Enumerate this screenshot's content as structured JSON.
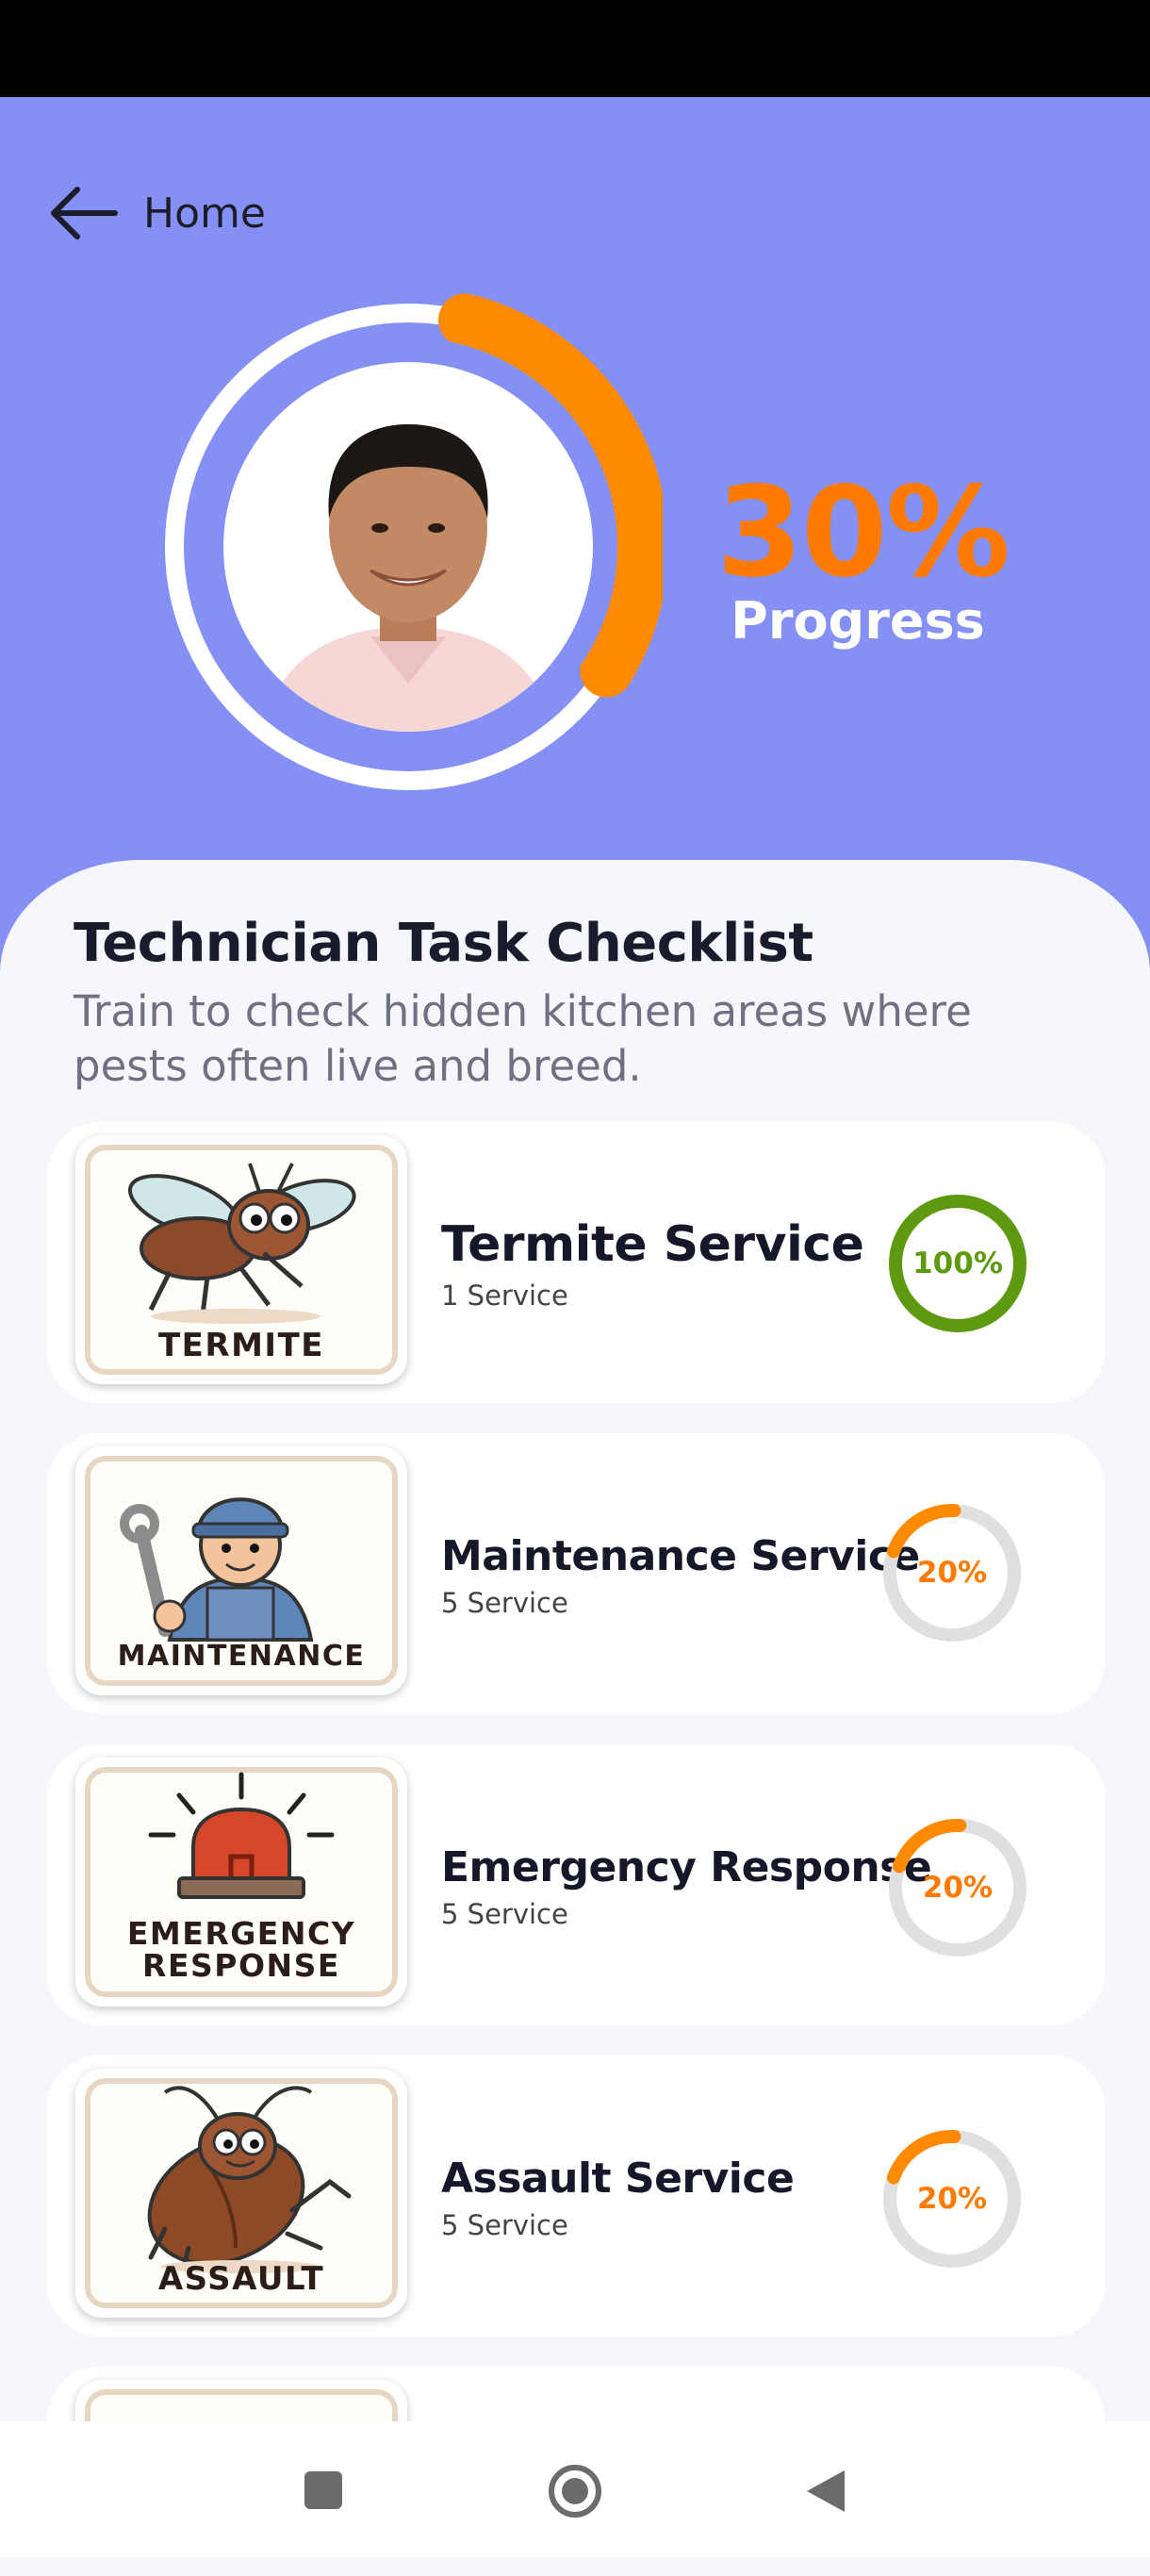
{
  "header": {
    "back_label": "Home",
    "progress_value": "30%",
    "progress_label": "Progress",
    "progress_fraction": 0.3
  },
  "checklist": {
    "title": "Technician Task Checklist",
    "subtitle": "Train to check hidden kitchen areas where pests often live and breed."
  },
  "tasks": [
    {
      "title": "Termite Service",
      "count": "1 Service",
      "percent_label": "100%",
      "progress": 1.0,
      "thumb_label": "TERMITE",
      "icon": "termite-icon"
    },
    {
      "title": "Maintenance Service",
      "count": "5 Service",
      "percent_label": "20%",
      "progress": 0.2,
      "thumb_label": "MAINTENANCE",
      "icon": "technician-wrench-icon"
    },
    {
      "title": "Emergency Response",
      "count": "5 Service",
      "percent_label": "20%",
      "progress": 0.2,
      "thumb_label_1": "EMERGENCY",
      "thumb_label_2": "RESPONSE",
      "icon": "siren-icon"
    },
    {
      "title": "Assault Service",
      "count": "5 Service",
      "percent_label": "20%",
      "progress": 0.2,
      "thumb_label": "ASSAULT",
      "icon": "cockroach-icon"
    }
  ],
  "colors": {
    "header_bg": "#8590f5",
    "accent_orange": "#ff7a00",
    "complete_green": "#5e9a0f",
    "ring_track": "#e0e0e0"
  },
  "nav": {
    "recents_icon": "square-icon",
    "home_icon": "circle-home-icon",
    "back_icon": "triangle-back-icon"
  }
}
